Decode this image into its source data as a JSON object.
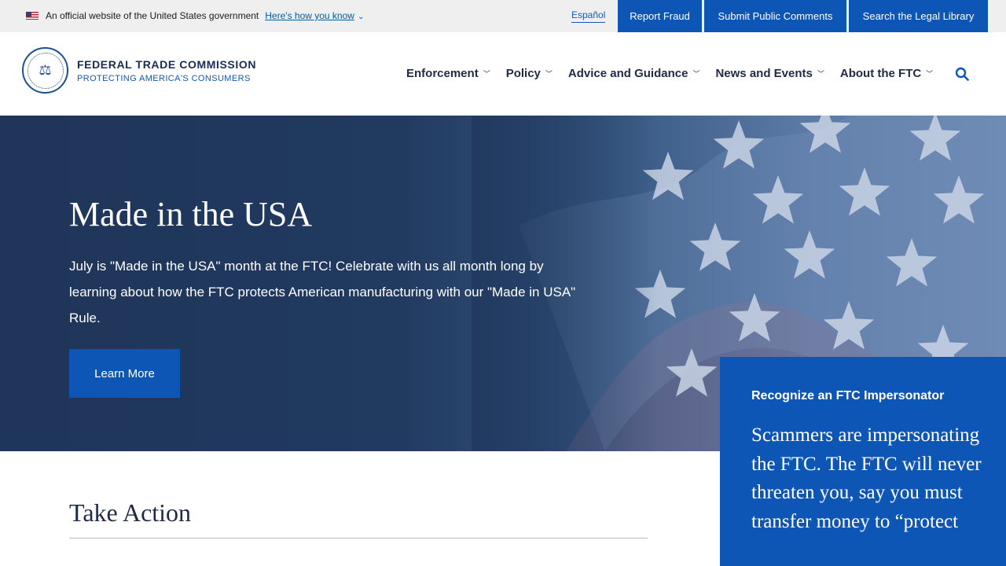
{
  "gov_banner": {
    "official_text": "An official website of the United States government",
    "how_link": "Here's how you know",
    "espanol": "Español",
    "buttons": [
      "Report Fraud",
      "Submit Public Comments",
      "Search the Legal Library"
    ]
  },
  "header": {
    "agency_name": "FEDERAL TRADE COMMISSION",
    "tagline": "PROTECTING AMERICA'S CONSUMERS",
    "nav": [
      "Enforcement",
      "Policy",
      "Advice and Guidance",
      "News and Events",
      "About the FTC"
    ]
  },
  "hero": {
    "title": "Made in the USA",
    "body": "July is \"Made in the USA\" month at the FTC! Celebrate with us all month long by learning about how the FTC protects American manufacturing with our \"Made in USA\" Rule.",
    "button": "Learn More"
  },
  "alert": {
    "title": "Recognize an FTC Impersonator",
    "body": "Scammers are impersonating the FTC. The FTC will never threaten you, say you must transfer money to “protect"
  },
  "section": {
    "title": "Take Action"
  },
  "colors": {
    "primary_blue": "#0e56b6",
    "hero_navy": "#1f3559",
    "banner_gray": "#efefef"
  },
  "icons": [
    "flag-icon",
    "chevron-down-icon",
    "ftc-seal-logo",
    "search-icon"
  ]
}
